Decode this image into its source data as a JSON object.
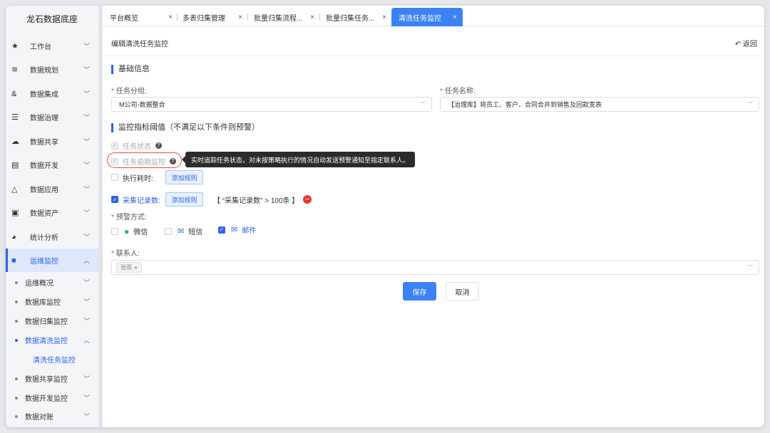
{
  "app": {
    "title": "龙石数据底座"
  },
  "sidebar": {
    "items": [
      {
        "label": "工作台",
        "icon": "star-icon"
      },
      {
        "label": "数据规划",
        "icon": "layers-icon"
      },
      {
        "label": "数据集成",
        "icon": "integration-icon"
      },
      {
        "label": "数据治理",
        "icon": "database-icon"
      },
      {
        "label": "数据共享",
        "icon": "cloud-icon"
      },
      {
        "label": "数据开发",
        "icon": "dev-icon"
      },
      {
        "label": "数据应用",
        "icon": "recycle-icon"
      },
      {
        "label": "数据资产",
        "icon": "asset-icon"
      },
      {
        "label": "统计分析",
        "icon": "pie-icon"
      },
      {
        "label": "运维监控",
        "icon": "monitor-icon"
      }
    ],
    "sub_items": [
      {
        "label": "运维概况"
      },
      {
        "label": "数据库监控"
      },
      {
        "label": "数据归集监控"
      },
      {
        "label": "数据清洗监控"
      },
      {
        "label": "清洗任务监控"
      },
      {
        "label": "数据共享监控"
      },
      {
        "label": "数据开发监控"
      },
      {
        "label": "数据对账"
      }
    ]
  },
  "tabs": [
    {
      "label": "平台概览"
    },
    {
      "label": "多表归集管理"
    },
    {
      "label": "批量归集流程..."
    },
    {
      "label": "批量归集任务..."
    },
    {
      "label": "清洗任务监控"
    }
  ],
  "tab_close": "×",
  "header": {
    "breadcrumb": "编辑清洗任务监控",
    "back_label": "返回"
  },
  "basic": {
    "section_title": "基础信息",
    "group_label": "任务分组:",
    "group_value": "M公司-数据整合",
    "name_label": "任务名称:",
    "name_value": "【治理库】将员工、客户、合同合并到销售及回款宽表"
  },
  "monitor": {
    "section_title": "监控指标阈值（不满足以下条件则预警）",
    "status_label": "任务状态",
    "overdue_label": "任务逾期监控",
    "tooltip": "实时追踪任务状态，对未按策略执行的情况自动发送预警通知至指定联系人。",
    "duration_label": "执行耗时:",
    "records_label": "采集记录数:",
    "add_rule_label": "添加规则",
    "rule_text": "【 “采集记录数” > 100条 】"
  },
  "alert": {
    "label": "预警方式:",
    "options": [
      {
        "label": "微信",
        "checked": false
      },
      {
        "label": "短信",
        "checked": false
      },
      {
        "label": "邮件",
        "checked": true
      }
    ]
  },
  "contact": {
    "label": "联系人:",
    "tag": "张雨"
  },
  "actions": {
    "save_label": "保存",
    "cancel_label": "取消"
  },
  "colors": {
    "accent": "#3b82f6",
    "danger": "#e53935",
    "wechat": "#2aae67"
  }
}
